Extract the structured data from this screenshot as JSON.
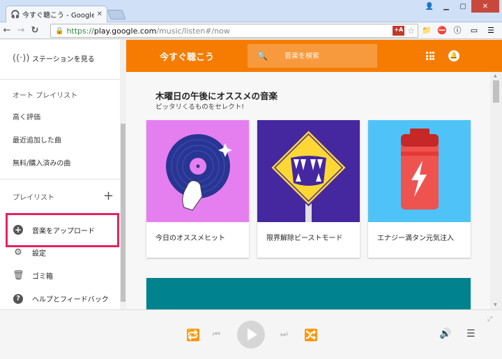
{
  "browser": {
    "tab_title": "今すぐ聴こう - Google Play",
    "url_scheme": "https://",
    "url_host": "play.google.com",
    "url_path": "/music/listen#/now",
    "ext_badge": "+A"
  },
  "sidebar": {
    "stations": "ステーションを見る",
    "auto_playlists_header": "オート プレイリスト",
    "auto_items": [
      "高く評価",
      "最近追加した曲",
      "無料/購入済みの曲"
    ],
    "playlists_header": "プレイリスト",
    "upload": "音楽をアップロード",
    "settings": "設定",
    "trash": "ゴミ箱",
    "help": "ヘルプとフィードバック"
  },
  "appbar": {
    "title": "今すぐ聴こう",
    "search_placeholder": "音楽を検索"
  },
  "recommendations": {
    "title": "木曜日の午後にオススメの音楽",
    "subtitle": "ピッタリくるものをセレクト!",
    "cards": [
      {
        "label": "今日のオススメヒット",
        "bg": "#e57ff0"
      },
      {
        "label": "限界解除ビーストモード",
        "bg": "#4527a0"
      },
      {
        "label": "エナジー満タン元気注入",
        "bg": "#4fc3f7"
      }
    ]
  },
  "colors": {
    "accent": "#f57c00",
    "highlight": "#e8215f",
    "teal": "#00838f"
  }
}
